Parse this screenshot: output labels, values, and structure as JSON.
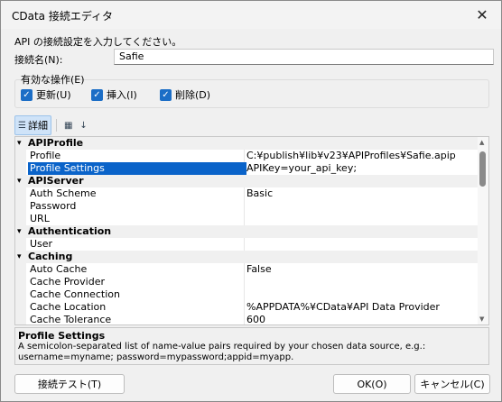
{
  "window": {
    "title": "CData 接続エディタ",
    "close_glyph": "✕"
  },
  "prompt": "API の接続設定を入力してください。",
  "connection_name": {
    "label": "接続名(N):",
    "value": "Safie"
  },
  "operations": {
    "label": "有効な操作(E)",
    "items": [
      {
        "label": "更新(U)",
        "checked": true
      },
      {
        "label": "挿入(I)",
        "checked": true
      },
      {
        "label": "削除(D)",
        "checked": true
      }
    ]
  },
  "toolbar": {
    "detail_label": "詳細",
    "sort_glyph": "↓"
  },
  "grid": {
    "rows": [
      {
        "type": "category",
        "name": "APIProfile"
      },
      {
        "type": "prop",
        "name": "Profile",
        "value": "C:¥publish¥lib¥v23¥APIProfiles¥Safie.apip"
      },
      {
        "type": "prop",
        "name": "Profile Settings",
        "value": "APIKey=your_api_key;",
        "selected": true
      },
      {
        "type": "category",
        "name": "APIServer"
      },
      {
        "type": "prop",
        "name": "Auth Scheme",
        "value": "Basic"
      },
      {
        "type": "prop",
        "name": "Password",
        "value": ""
      },
      {
        "type": "prop",
        "name": "URL",
        "value": ""
      },
      {
        "type": "category",
        "name": "Authentication"
      },
      {
        "type": "prop",
        "name": "User",
        "value": ""
      },
      {
        "type": "category",
        "name": "Caching"
      },
      {
        "type": "prop",
        "name": "Auto Cache",
        "value": "False"
      },
      {
        "type": "prop",
        "name": "Cache Provider",
        "value": ""
      },
      {
        "type": "prop",
        "name": "Cache Connection",
        "value": ""
      },
      {
        "type": "prop",
        "name": "Cache Location",
        "value": "%APPDATA%¥CData¥API Data Provider"
      },
      {
        "type": "prop",
        "name": "Cache Tolerance",
        "value": "600"
      }
    ]
  },
  "description": {
    "title": "Profile Settings",
    "text": "A semicolon-separated list of name-value pairs required by your chosen data source, e.g.: username=myname; password=mypassword;appid=myapp."
  },
  "buttons": {
    "test": "接続テスト(T)",
    "ok": "OK(O)",
    "cancel": "キャンセル(C)"
  }
}
